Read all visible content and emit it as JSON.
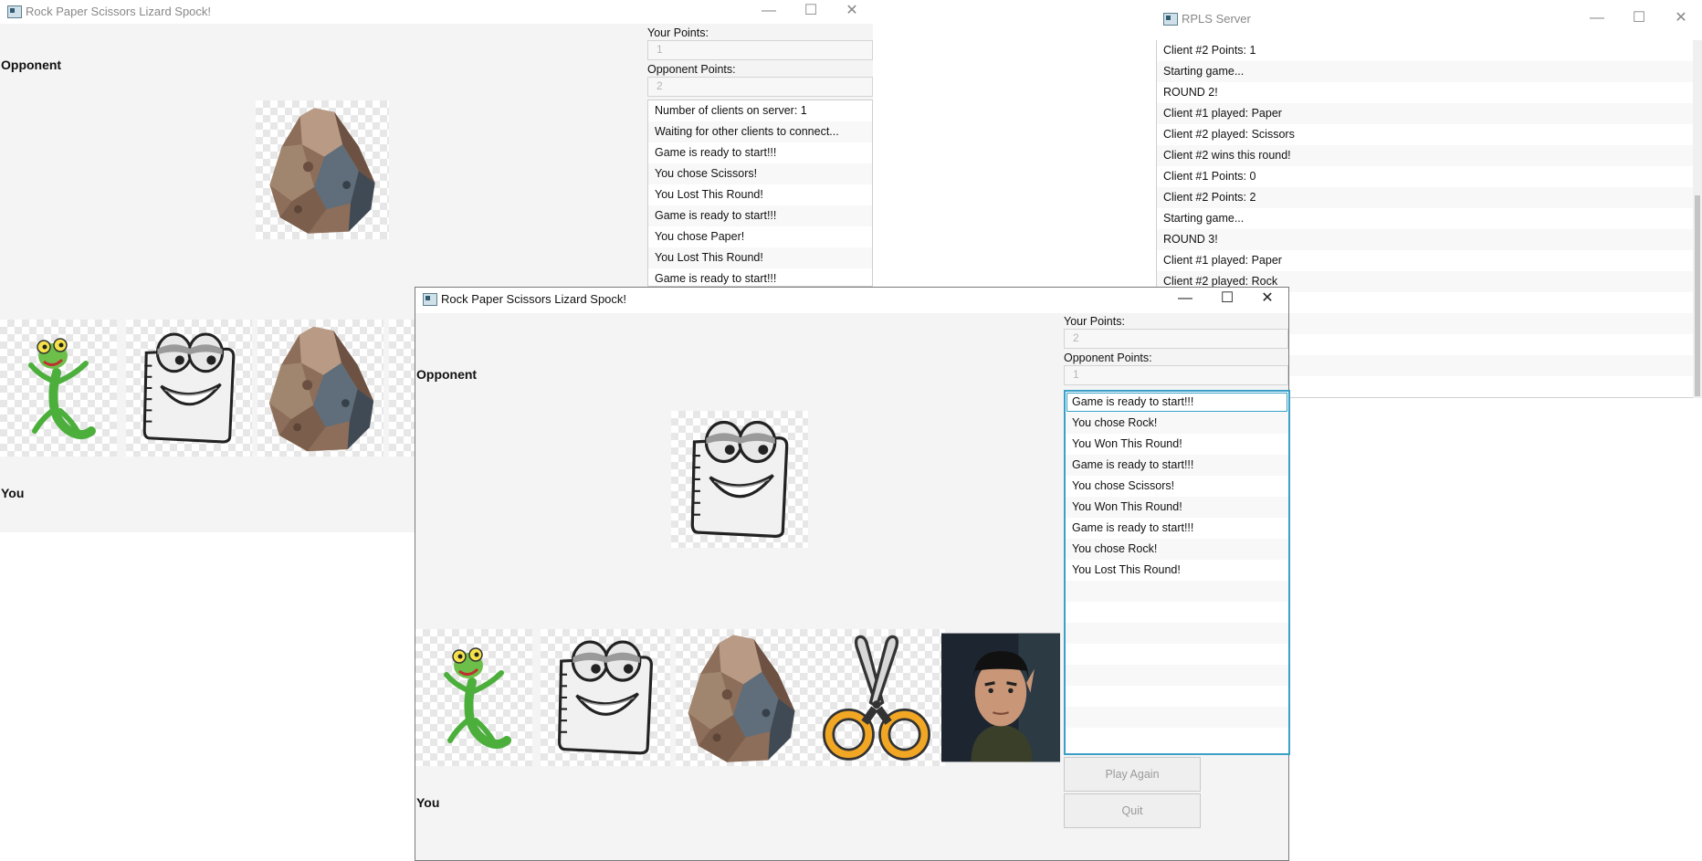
{
  "window_back": {
    "title": "Rock Paper Scissors Lizard Spock!",
    "your_points_label": "Your Points:",
    "your_points_value": "1",
    "opponent_points_label": "Opponent Points:",
    "opponent_points_value": "2",
    "opponent_label": "Opponent",
    "you_label": "You",
    "log": [
      "Number of clients on server: 1",
      "Waiting for other clients to connect...",
      "Game is ready to start!!!",
      "You chose Scissors!",
      "You Lost This Round!",
      "Game is ready to start!!!",
      "You chose Paper!",
      "You Lost This Round!",
      "Game is ready to start!!!"
    ]
  },
  "server_window": {
    "title": "RPLS Server",
    "log": [
      "Client #2 Points: 1",
      "Starting game...",
      "ROUND 2!",
      "Client #1 played: Paper",
      "Client #2 played: Scissors",
      "Client #2 wins this round!",
      "Client #1 Points: 0",
      "Client #2 Points: 2",
      "Starting game...",
      "ROUND 3!",
      "Client #1 played: Paper",
      "Client #2 played: Rock"
    ]
  },
  "window_front": {
    "title": "Rock Paper Scissors Lizard Spock!",
    "your_points_label": "Your Points:",
    "your_points_value": "2",
    "opponent_points_label": "Opponent Points:",
    "opponent_points_value": "1",
    "opponent_label": "Opponent",
    "you_label": "You",
    "log": [
      "Game is ready to start!!!",
      "You chose Rock!",
      "You Won This Round!",
      "Game is ready to start!!!",
      "You chose Scissors!",
      "You Won This Round!",
      "Game is ready to start!!!",
      "You chose Rock!",
      "You Lost This Round!"
    ],
    "play_again_label": "Play Again",
    "quit_label": "Quit"
  },
  "window_controls": {
    "minimize": "—",
    "maximize": "☐",
    "close": "✕"
  },
  "choices": [
    "Lizard",
    "Paper",
    "Rock",
    "Scissors",
    "Spock"
  ],
  "colors": {
    "focus_border": "#3aa0c8",
    "scissors_handle": "#f2a724"
  }
}
